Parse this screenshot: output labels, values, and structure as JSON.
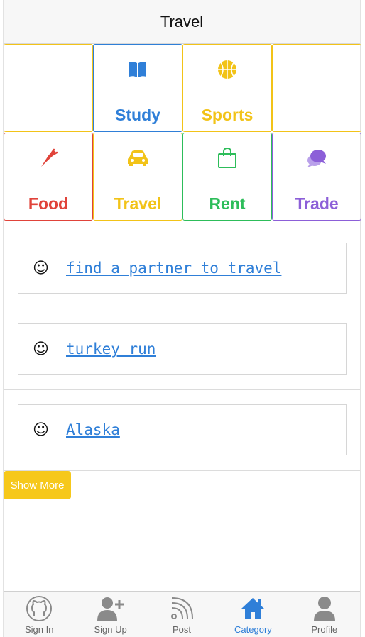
{
  "header": {
    "title": "Travel"
  },
  "categories": [
    {
      "label": "",
      "color": "#f2c318",
      "icon": ""
    },
    {
      "label": "Study",
      "color": "#2f7fd8",
      "icon": "book-icon"
    },
    {
      "label": "Sports",
      "color": "#f2c318",
      "icon": "basketball-icon"
    },
    {
      "label": "",
      "color": "#f2c318",
      "icon": ""
    },
    {
      "label": "Food",
      "color": "#e0433a",
      "icon": "carrot-icon"
    },
    {
      "label": "Travel",
      "color": "#f2c318",
      "icon": "car-icon"
    },
    {
      "label": "Rent",
      "color": "#2dbd5a",
      "icon": "shopping-bag-icon"
    },
    {
      "label": "Trade",
      "color": "#8c5fd8",
      "icon": "chat-bubbles-icon"
    }
  ],
  "posts": [
    {
      "emoji": "☺",
      "title": "find a partner to travel"
    },
    {
      "emoji": "☺",
      "title": "turkey run"
    },
    {
      "emoji": "☺",
      "title": "Alaska"
    }
  ],
  "show_more": {
    "label": "Show More",
    "color": "#f6c81b"
  },
  "tabbar": {
    "active_color": "#2f7fd8",
    "items": [
      {
        "label": "Sign In",
        "icon": "github-icon"
      },
      {
        "label": "Sign Up",
        "icon": "add-user-icon"
      },
      {
        "label": "Post",
        "icon": "rss-icon"
      },
      {
        "label": "Category",
        "icon": "home-icon",
        "active": true
      },
      {
        "label": "Profile",
        "icon": "profile-icon"
      }
    ]
  }
}
